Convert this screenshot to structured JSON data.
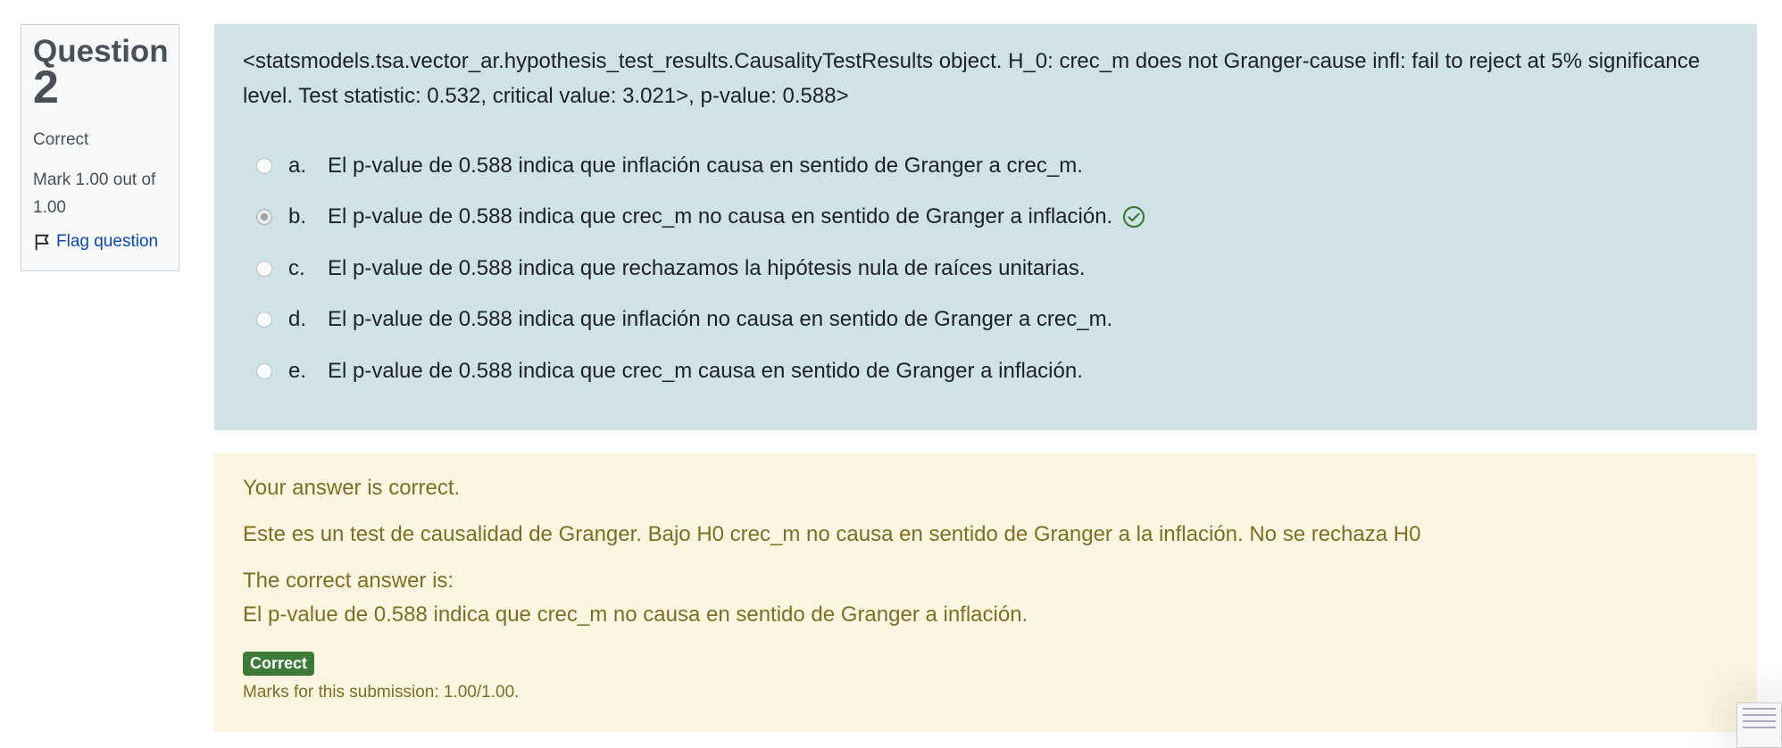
{
  "info": {
    "question_label": "Question",
    "question_number": "2",
    "state": "Correct",
    "grade": "Mark 1.00 out of 1.00",
    "flag_label": "Flag question"
  },
  "question": {
    "text": "<statsmodels.tsa.vector_ar.hypothesis_test_results.CausalityTestResults object. H_0: crec_m does not Granger-cause infl: fail to reject at 5% significance level. Test statistic: 0.532, critical value: 3.021>, p-value: 0.588>",
    "answers": [
      {
        "letter": "a.",
        "text": "El p-value de 0.588 indica que inflación causa en sentido de Granger a crec_m.",
        "selected": false
      },
      {
        "letter": "b.",
        "text": "El p-value de 0.588 indica que crec_m no causa en sentido de Granger a inflación.",
        "selected": true
      },
      {
        "letter": "c.",
        "text": "El p-value de 0.588 indica que rechazamos la hipótesis nula de raíces unitarias.",
        "selected": false
      },
      {
        "letter": "d.",
        "text": "El p-value de 0.588 indica que inflación no causa en sentido de Granger a crec_m.",
        "selected": false
      },
      {
        "letter": "e.",
        "text": "El p-value de 0.588 indica que crec_m causa en sentido de Granger a inflación.",
        "selected": false
      }
    ]
  },
  "feedback": {
    "specific": "Your answer is correct.",
    "general": "Este es un test de causalidad de Granger. Bajo H0 crec_m no causa en sentido de Granger a la inflación. No se rechaza H0",
    "right_answer_label": "The correct answer is:",
    "right_answer": "El p-value de 0.588 indica que crec_m no causa en sentido de Granger a inflación.",
    "badge": "Correct",
    "marks": "Marks for this submission: 1.00/1.00."
  },
  "colors": {
    "formulation_bg": "#cfe2e6",
    "feedback_bg": "#fcf6e0",
    "feedback_text": "#7d6e28",
    "badge_bg": "#3e7a3a",
    "link": "#0f47ad"
  }
}
